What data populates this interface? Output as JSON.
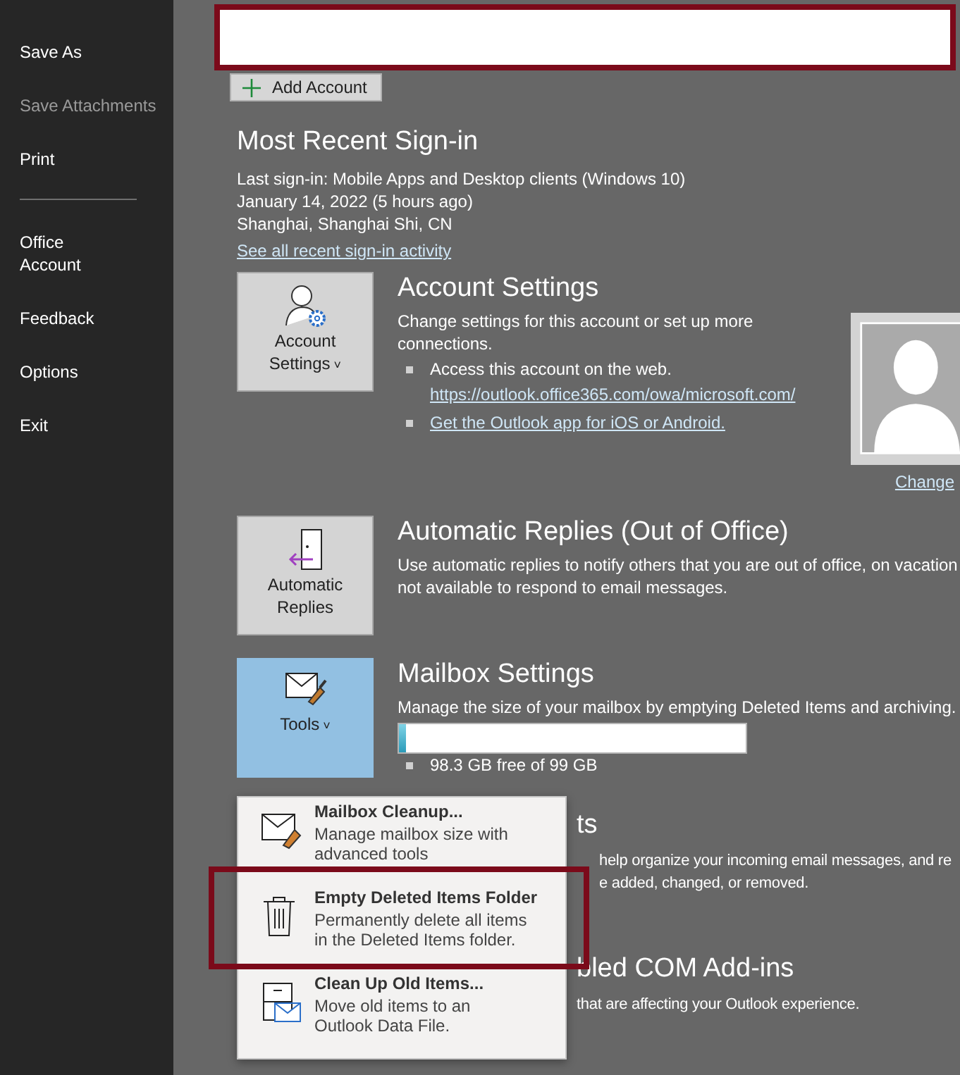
{
  "sidebar": {
    "groups": [
      {
        "items": [
          {
            "label": "Save As",
            "disabled": false
          },
          {
            "label": "Save Attachments",
            "disabled": true
          },
          {
            "label": "Print",
            "disabled": false
          }
        ]
      },
      {
        "items": [
          {
            "label": "Office\nAccount",
            "disabled": false
          },
          {
            "label": "Feedback",
            "disabled": false
          },
          {
            "label": "Options",
            "disabled": false
          },
          {
            "label": "Exit",
            "disabled": false
          }
        ]
      }
    ]
  },
  "add_account": {
    "label": "Add Account"
  },
  "sign_in": {
    "title": "Most Recent Sign-in",
    "lines": [
      "Last sign-in: Mobile Apps and Desktop clients (Windows 10)",
      "January 14, 2022 (5 hours ago)",
      "Shanghai, Shanghai Shi, CN"
    ],
    "link": "See all recent sign-in activity"
  },
  "sections": [
    {
      "kind": "account",
      "tile": {
        "label": "Account\nSettings",
        "caret": "˅",
        "expanded": false
      },
      "title": "Account Settings",
      "description": "Change settings for this account or set up more connections.",
      "bullets": [
        {
          "text": "Access this account on the web.",
          "link": "https://outlook.office365.com/owa/microsoft.com/"
        },
        {
          "link": "Get the Outlook app for iOS or Android."
        }
      ],
      "photo": {
        "link": "Change"
      }
    },
    {
      "kind": "replies",
      "tile": {
        "label": "Automatic\nReplies",
        "expanded": false
      },
      "title": "Automatic Replies (Out of Office)",
      "description": "Use automatic replies to notify others that you are out of office, on vacation\nnot available to respond to email messages."
    },
    {
      "kind": "tools",
      "tile": {
        "label": "Tools",
        "caret": "˅",
        "expanded": true
      },
      "title": "Mailbox Settings",
      "description": "Manage the size of your mailbox by emptying Deleted Items and archiving.",
      "usage": {
        "level": 0.02,
        "text": "98.3 GB free of 99 GB"
      }
    },
    {
      "kind": "covered",
      "title": "ts",
      "lines": [
        "help organize your incoming email messages, and re",
        "e added, changed, or removed."
      ]
    },
    {
      "kind": "covered",
      "title": "bled COM Add-ins",
      "lines": [
        "that are affecting your Outlook experience."
      ]
    }
  ],
  "tools_menu": [
    {
      "kind": "cleanup",
      "title": "Mailbox Cleanup...",
      "description": "Manage mailbox size with\nadvanced tools"
    },
    {
      "kind": "trash",
      "title": "Empty Deleted Items Folder",
      "description": "Permanently delete all items\nin the Deleted Items folder."
    },
    {
      "kind": "archive",
      "title": "Clean Up Old Items...",
      "description": "Move old items to an\nOutlook Data File."
    }
  ]
}
